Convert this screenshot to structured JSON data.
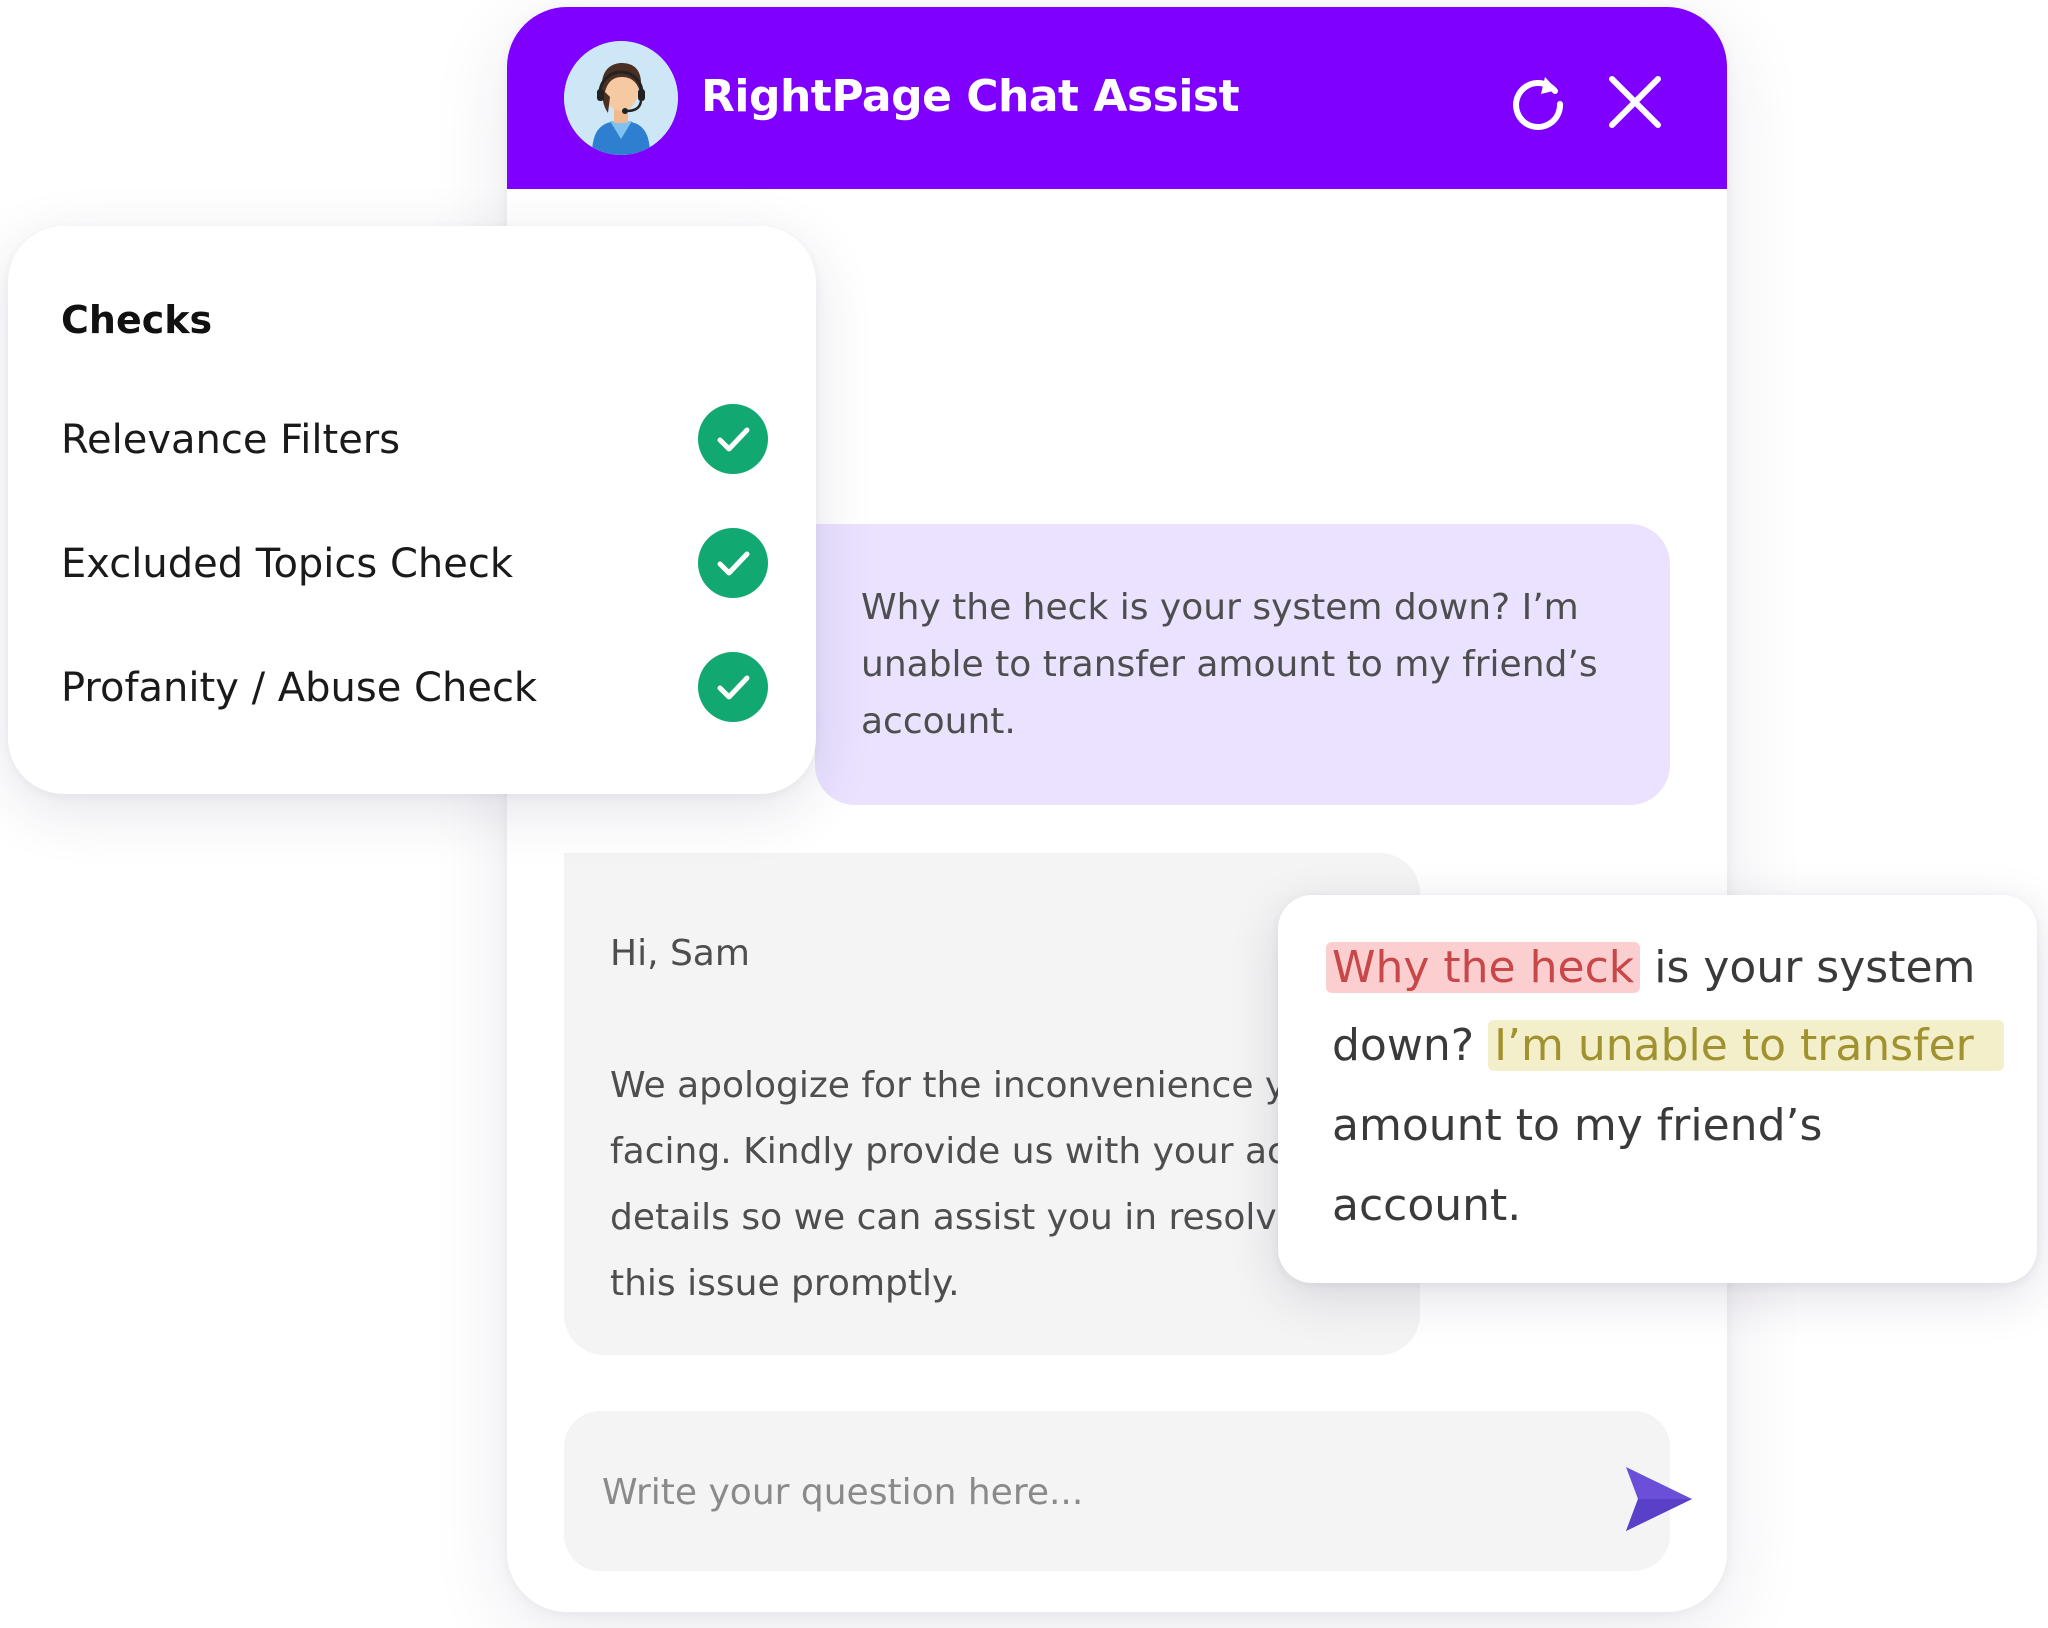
{
  "header": {
    "title": "RightPage Chat Assist",
    "refresh_icon": "refresh-icon",
    "close_icon": "close-icon",
    "avatar_icon": "support-agent-avatar"
  },
  "colors": {
    "header_bg": "#7f00ff",
    "user_bubble_bg": "#eae2ff",
    "bot_bubble_bg": "#f4f4f4",
    "check_green": "#12a871",
    "send_icon": "#6b4fd8",
    "profanity_highlight": "#fbcfcf",
    "complaint_highlight": "#f4efcb"
  },
  "messages": {
    "user": {
      "line1": "Why the heck is your system down? I’m",
      "line2": "unable to transfer amount to my friend’s",
      "line3": "account."
    },
    "bot": {
      "greeting": "Hi, Sam",
      "line1": "We apologize for the inconvenience y",
      "line2": "facing. Kindly provide us with your acc",
      "line3": "details so we can assist you in resolvin",
      "line4": "this issue promptly."
    }
  },
  "input": {
    "placeholder": "Write your question here...",
    "value": "",
    "send_icon": "send-icon"
  },
  "checks": {
    "title": "Checks",
    "items": [
      {
        "label": "Relevance Filters",
        "status": "passed",
        "icon": "check-circle-icon"
      },
      {
        "label": "Excluded Topics Check",
        "status": "passed",
        "icon": "check-circle-icon"
      },
      {
        "label": "Profanity / Abuse Check",
        "status": "passed",
        "icon": "check-circle-icon"
      }
    ]
  },
  "highlight": {
    "flagged": "Why the heck",
    "segment1": "is your system",
    "segment2": "down?",
    "complaint": "I’m unable to transfer",
    "segment3": "amount to my friend’s",
    "segment4": "account."
  }
}
